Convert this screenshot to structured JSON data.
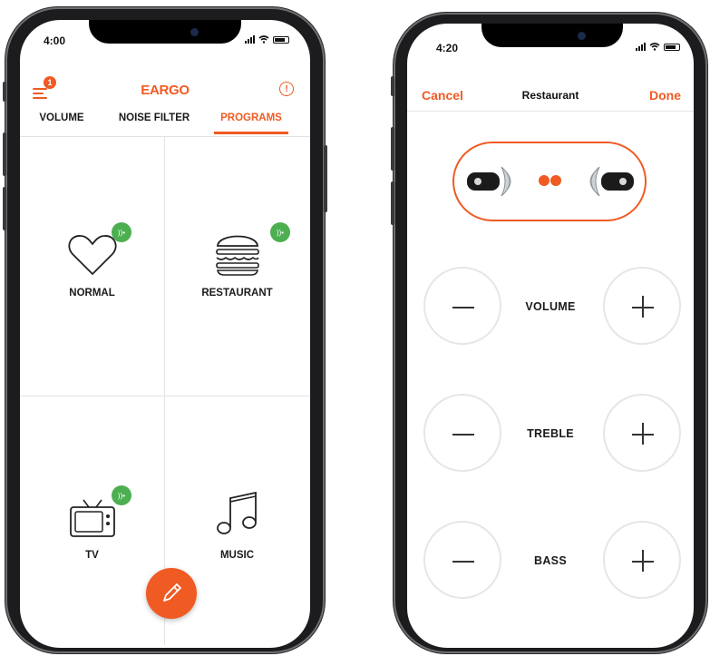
{
  "left_phone": {
    "status": {
      "time": "4:00"
    },
    "header": {
      "logo": "EARGO",
      "notification_count": "1"
    },
    "tabs": [
      {
        "label": "VOLUME",
        "active": false
      },
      {
        "label": "NOISE FILTER",
        "active": false
      },
      {
        "label": "PROGRAMS",
        "active": true
      }
    ],
    "programs": [
      {
        "label": "NORMAL",
        "icon": "heart-icon",
        "has_badge": true
      },
      {
        "label": "RESTAURANT",
        "icon": "burger-icon",
        "has_badge": true
      },
      {
        "label": "TV",
        "icon": "tv-icon",
        "has_badge": true
      },
      {
        "label": "MUSIC",
        "icon": "music-note-icon",
        "has_badge": false
      }
    ]
  },
  "right_phone": {
    "status": {
      "time": "4:20"
    },
    "header": {
      "cancel_label": "Cancel",
      "title": "Restaurant",
      "done_label": "Done"
    },
    "controls": [
      {
        "label": "VOLUME"
      },
      {
        "label": "TREBLE"
      },
      {
        "label": "BASS"
      }
    ]
  },
  "colors": {
    "accent": "#f05a23",
    "badge_green": "#4caf50",
    "divider": "#e2e2e2",
    "text": "#1a1a1a"
  }
}
